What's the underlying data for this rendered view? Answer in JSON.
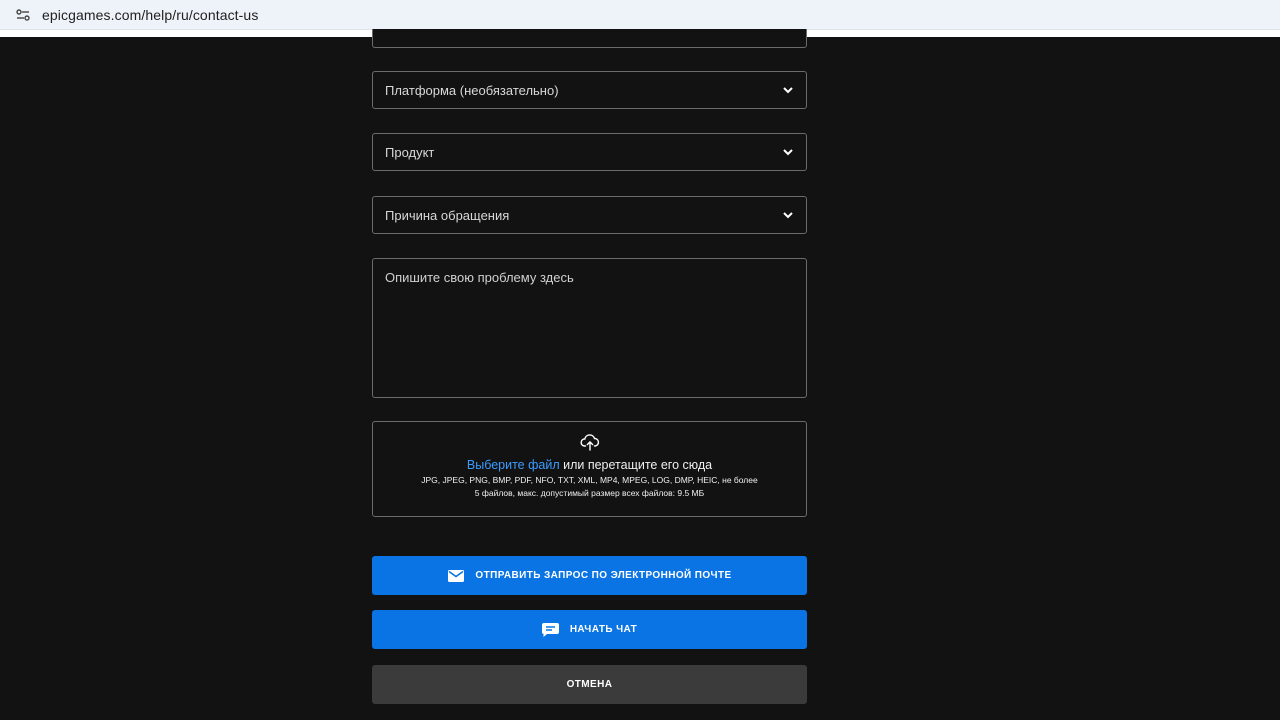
{
  "browser": {
    "url": "epicgames.com/help/ru/contact-us",
    "site_info_icon": "tune-icon"
  },
  "form": {
    "fields": [
      {
        "label": "Платформа (необязательно)",
        "icon": "chevron-down-icon"
      },
      {
        "label": "Продукт",
        "icon": "chevron-down-icon"
      },
      {
        "label": "Причина обращения",
        "icon": "chevron-down-icon"
      }
    ],
    "description_placeholder": "Опишите свою проблему здесь",
    "upload": {
      "icon": "cloud-upload-icon",
      "link_text": "Выберите файл",
      "rest_text": " или перетащите его сюда",
      "formats_line": "JPG, JPEG, PNG, BMP, PDF, NFO, TXT, XML, MP4, MPEG, LOG, DMP, HEIC, не более",
      "limits_line": "5 файлов, макс. допустимый размер всех файлов: 9.5 МБ"
    }
  },
  "buttons": {
    "email_label": "ОТПРАВИТЬ ЗАПРОС ПО ЭЛЕКТРОННОЙ ПОЧТЕ",
    "email_icon": "mail-icon",
    "chat_label": "НАЧАТЬ ЧАТ",
    "chat_icon": "chat-icon",
    "cancel_label": "ОТМЕНА"
  },
  "colors": {
    "background": "#121212",
    "primary": "#0a74e4",
    "secondary": "#3b3b3b",
    "link": "#3b9cff",
    "border": "#6b6b6b"
  }
}
